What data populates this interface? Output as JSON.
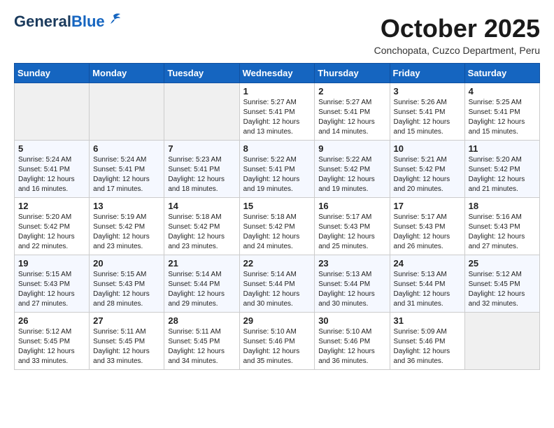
{
  "header": {
    "logo_line1": "General",
    "logo_line2": "Blue",
    "month_title": "October 2025",
    "location": "Conchopata, Cuzco Department, Peru"
  },
  "weekdays": [
    "Sunday",
    "Monday",
    "Tuesday",
    "Wednesday",
    "Thursday",
    "Friday",
    "Saturday"
  ],
  "weeks": [
    [
      {
        "day": "",
        "info": ""
      },
      {
        "day": "",
        "info": ""
      },
      {
        "day": "",
        "info": ""
      },
      {
        "day": "1",
        "info": "Sunrise: 5:27 AM\nSunset: 5:41 PM\nDaylight: 12 hours\nand 13 minutes."
      },
      {
        "day": "2",
        "info": "Sunrise: 5:27 AM\nSunset: 5:41 PM\nDaylight: 12 hours\nand 14 minutes."
      },
      {
        "day": "3",
        "info": "Sunrise: 5:26 AM\nSunset: 5:41 PM\nDaylight: 12 hours\nand 15 minutes."
      },
      {
        "day": "4",
        "info": "Sunrise: 5:25 AM\nSunset: 5:41 PM\nDaylight: 12 hours\nand 15 minutes."
      }
    ],
    [
      {
        "day": "5",
        "info": "Sunrise: 5:24 AM\nSunset: 5:41 PM\nDaylight: 12 hours\nand 16 minutes."
      },
      {
        "day": "6",
        "info": "Sunrise: 5:24 AM\nSunset: 5:41 PM\nDaylight: 12 hours\nand 17 minutes."
      },
      {
        "day": "7",
        "info": "Sunrise: 5:23 AM\nSunset: 5:41 PM\nDaylight: 12 hours\nand 18 minutes."
      },
      {
        "day": "8",
        "info": "Sunrise: 5:22 AM\nSunset: 5:41 PM\nDaylight: 12 hours\nand 19 minutes."
      },
      {
        "day": "9",
        "info": "Sunrise: 5:22 AM\nSunset: 5:42 PM\nDaylight: 12 hours\nand 19 minutes."
      },
      {
        "day": "10",
        "info": "Sunrise: 5:21 AM\nSunset: 5:42 PM\nDaylight: 12 hours\nand 20 minutes."
      },
      {
        "day": "11",
        "info": "Sunrise: 5:20 AM\nSunset: 5:42 PM\nDaylight: 12 hours\nand 21 minutes."
      }
    ],
    [
      {
        "day": "12",
        "info": "Sunrise: 5:20 AM\nSunset: 5:42 PM\nDaylight: 12 hours\nand 22 minutes."
      },
      {
        "day": "13",
        "info": "Sunrise: 5:19 AM\nSunset: 5:42 PM\nDaylight: 12 hours\nand 23 minutes."
      },
      {
        "day": "14",
        "info": "Sunrise: 5:18 AM\nSunset: 5:42 PM\nDaylight: 12 hours\nand 23 minutes."
      },
      {
        "day": "15",
        "info": "Sunrise: 5:18 AM\nSunset: 5:42 PM\nDaylight: 12 hours\nand 24 minutes."
      },
      {
        "day": "16",
        "info": "Sunrise: 5:17 AM\nSunset: 5:43 PM\nDaylight: 12 hours\nand 25 minutes."
      },
      {
        "day": "17",
        "info": "Sunrise: 5:17 AM\nSunset: 5:43 PM\nDaylight: 12 hours\nand 26 minutes."
      },
      {
        "day": "18",
        "info": "Sunrise: 5:16 AM\nSunset: 5:43 PM\nDaylight: 12 hours\nand 27 minutes."
      }
    ],
    [
      {
        "day": "19",
        "info": "Sunrise: 5:15 AM\nSunset: 5:43 PM\nDaylight: 12 hours\nand 27 minutes."
      },
      {
        "day": "20",
        "info": "Sunrise: 5:15 AM\nSunset: 5:43 PM\nDaylight: 12 hours\nand 28 minutes."
      },
      {
        "day": "21",
        "info": "Sunrise: 5:14 AM\nSunset: 5:44 PM\nDaylight: 12 hours\nand 29 minutes."
      },
      {
        "day": "22",
        "info": "Sunrise: 5:14 AM\nSunset: 5:44 PM\nDaylight: 12 hours\nand 30 minutes."
      },
      {
        "day": "23",
        "info": "Sunrise: 5:13 AM\nSunset: 5:44 PM\nDaylight: 12 hours\nand 30 minutes."
      },
      {
        "day": "24",
        "info": "Sunrise: 5:13 AM\nSunset: 5:44 PM\nDaylight: 12 hours\nand 31 minutes."
      },
      {
        "day": "25",
        "info": "Sunrise: 5:12 AM\nSunset: 5:45 PM\nDaylight: 12 hours\nand 32 minutes."
      }
    ],
    [
      {
        "day": "26",
        "info": "Sunrise: 5:12 AM\nSunset: 5:45 PM\nDaylight: 12 hours\nand 33 minutes."
      },
      {
        "day": "27",
        "info": "Sunrise: 5:11 AM\nSunset: 5:45 PM\nDaylight: 12 hours\nand 33 minutes."
      },
      {
        "day": "28",
        "info": "Sunrise: 5:11 AM\nSunset: 5:45 PM\nDaylight: 12 hours\nand 34 minutes."
      },
      {
        "day": "29",
        "info": "Sunrise: 5:10 AM\nSunset: 5:46 PM\nDaylight: 12 hours\nand 35 minutes."
      },
      {
        "day": "30",
        "info": "Sunrise: 5:10 AM\nSunset: 5:46 PM\nDaylight: 12 hours\nand 36 minutes."
      },
      {
        "day": "31",
        "info": "Sunrise: 5:09 AM\nSunset: 5:46 PM\nDaylight: 12 hours\nand 36 minutes."
      },
      {
        "day": "",
        "info": ""
      }
    ]
  ]
}
